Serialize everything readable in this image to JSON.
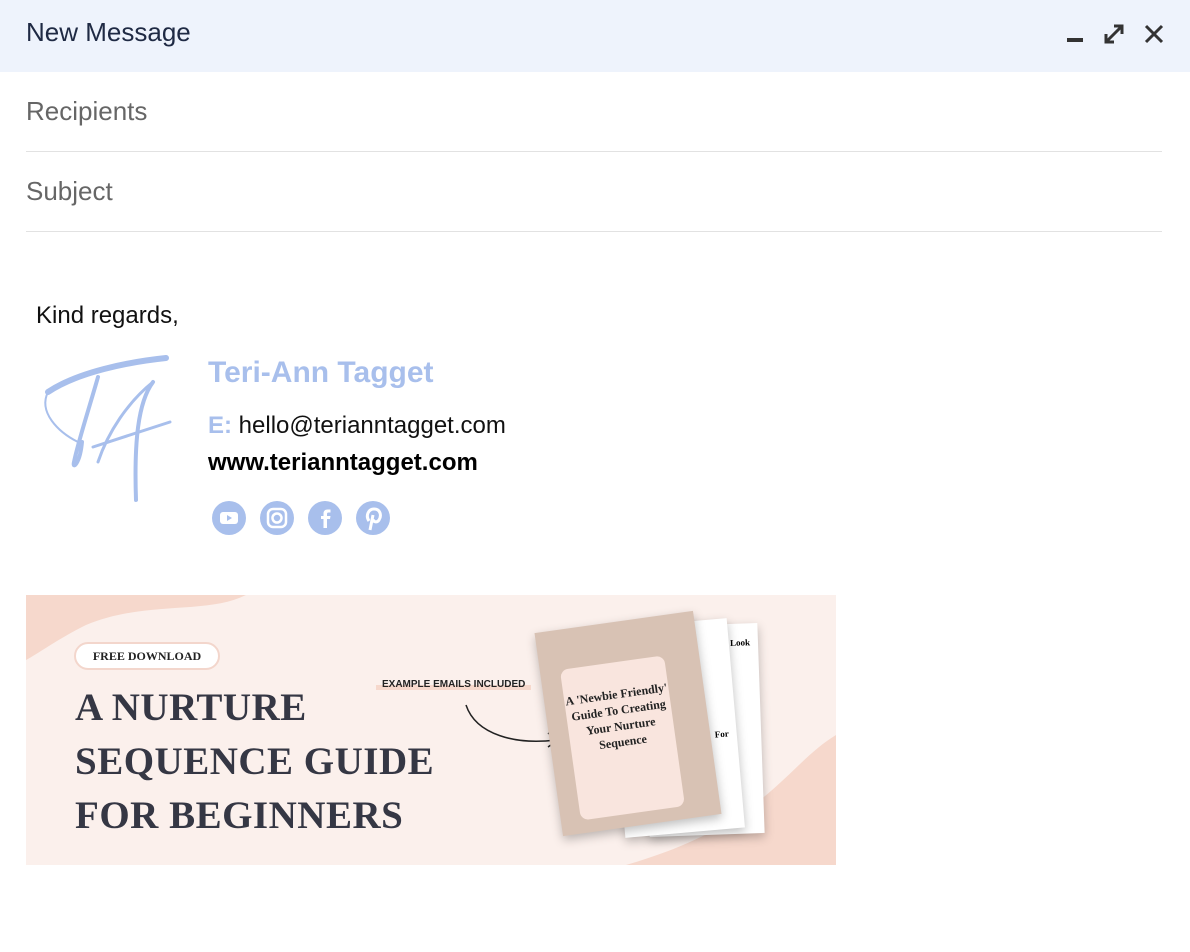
{
  "window": {
    "title": "New Message",
    "controls": [
      "minimize-icon",
      "expand-icon",
      "close-icon"
    ]
  },
  "fields": {
    "recipients_placeholder": "Recipients",
    "subject_placeholder": "Subject"
  },
  "body": {
    "greeting": "Kind regards,",
    "signature": {
      "logo": "TA",
      "name": "Teri-Ann Tagget",
      "email_label": "E:",
      "email": "hello@terianntagget.com",
      "website": "www.terianntagget.com",
      "social": [
        "youtube-icon",
        "instagram-icon",
        "facebook-icon",
        "pinterest-icon"
      ],
      "accent": "#a8bfec"
    },
    "banner": {
      "badge": "FREE DOWNLOAD",
      "headline": [
        "A NURTURE",
        "SEQUENCE GUIDE",
        "FOR BEGINNERS"
      ],
      "callout": "EXAMPLE EMAILS INCLUDED",
      "cover_title": "A 'Newbie Friendly' Guide To Creating Your Nurture Sequence",
      "page_words": [
        "Look",
        "For"
      ],
      "background": "#fbf0ec"
    }
  }
}
